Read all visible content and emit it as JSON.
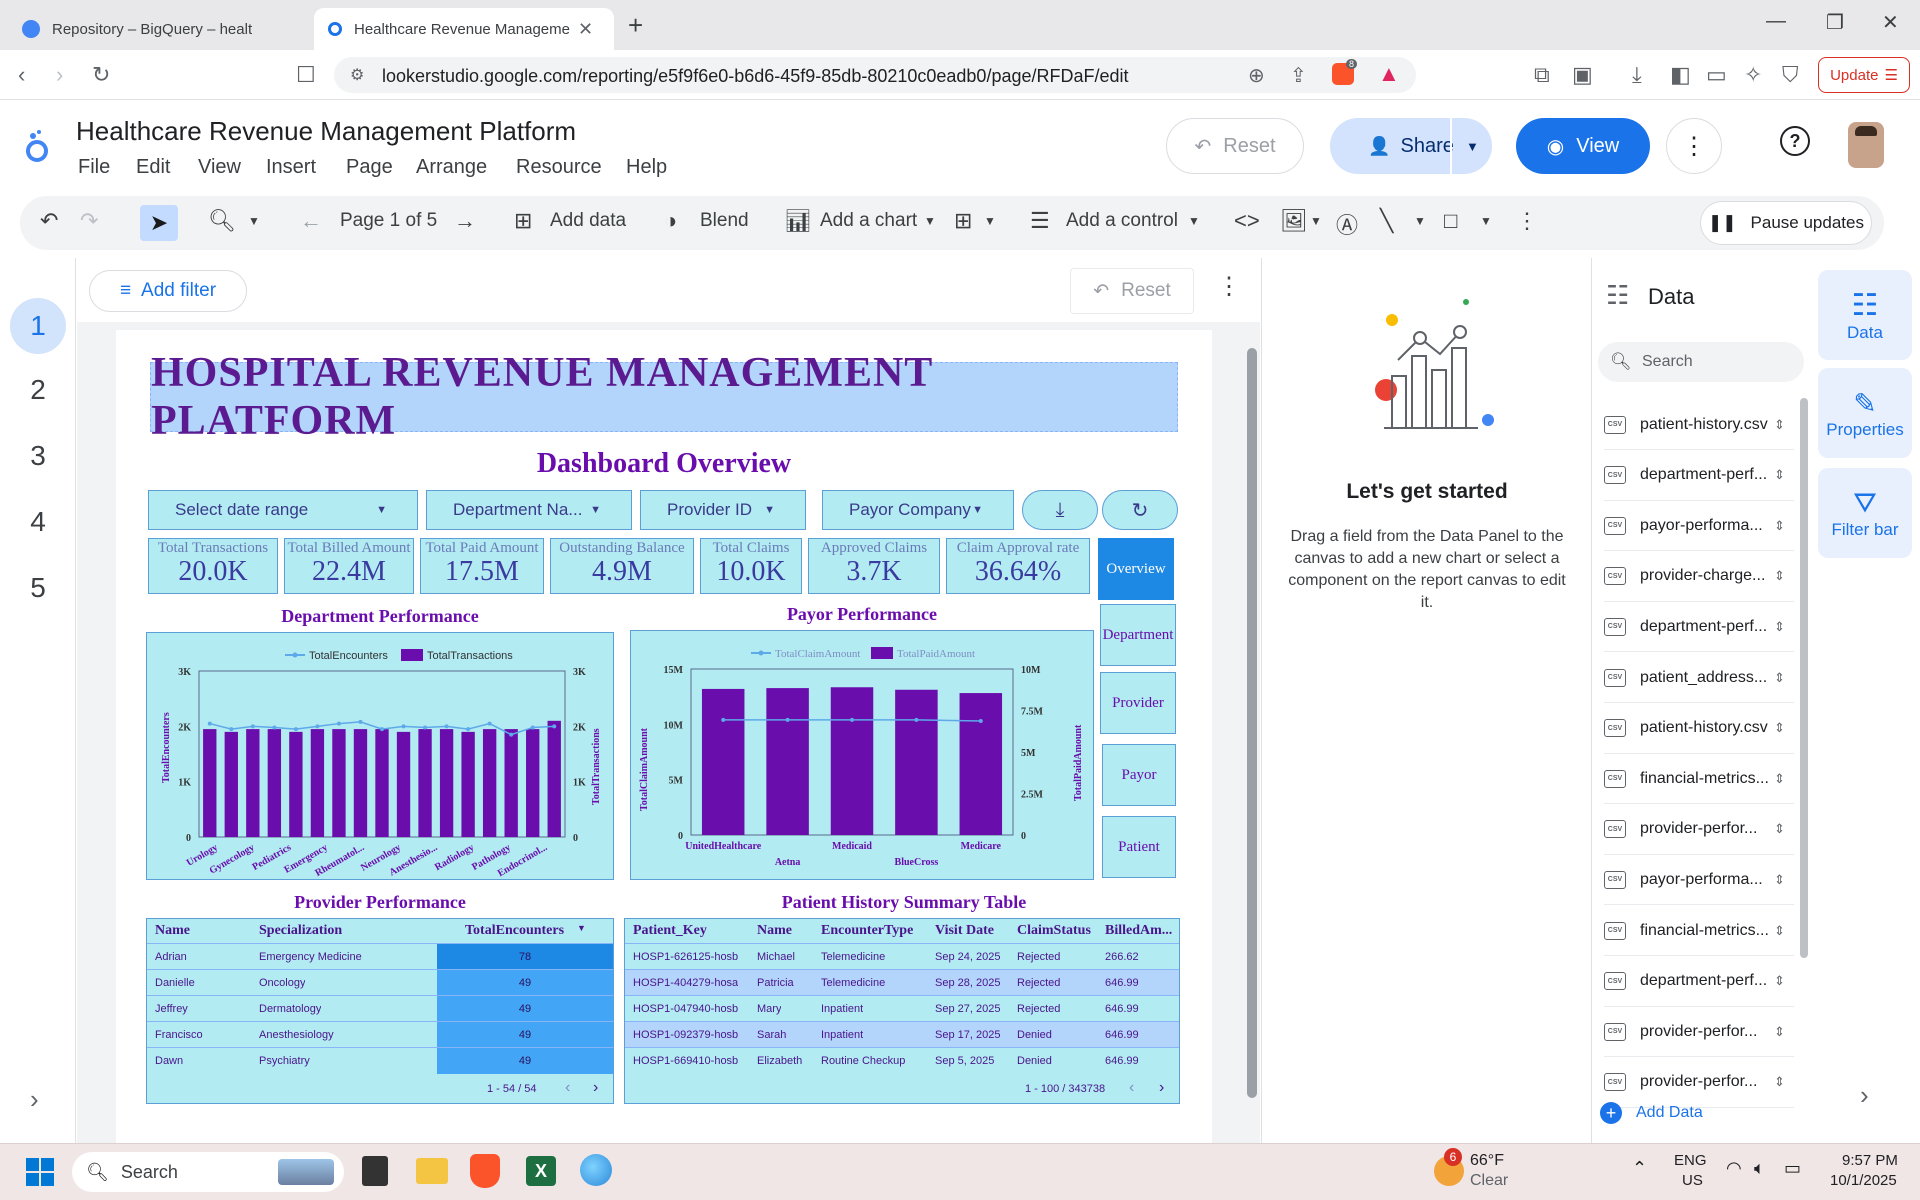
{
  "browser": {
    "tabs": [
      {
        "label": "Repository – BigQuery – healthcare d",
        "active": false
      },
      {
        "label": "Healthcare Revenue Managemen",
        "active": true
      }
    ],
    "url": "lookerstudio.google.com/reporting/e5f9f6e0-b6d6-45f9-85db-80210c0eadb0/page/RFDaF/edit",
    "update_label": "Update",
    "extension_badge": "8"
  },
  "app": {
    "report_title": "Healthcare Revenue Management Platform",
    "menus": [
      "File",
      "Edit",
      "View",
      "Insert",
      "Page",
      "Arrange",
      "Resource",
      "Help"
    ],
    "reset_label": "Reset",
    "share_label": "Share",
    "view_label": "View"
  },
  "toolbar": {
    "page_indicator": "Page 1 of 5",
    "add_data": "Add data",
    "blend": "Blend",
    "add_chart": "Add a chart",
    "add_control": "Add a control",
    "pause_updates": "Pause updates"
  },
  "pages": [
    "1",
    "2",
    "3",
    "4",
    "5"
  ],
  "filterbar": {
    "add_filter": "Add filter",
    "reset": "Reset"
  },
  "dashboard": {
    "banner": "HOSPITAL REVENUE MANAGEMENT PLATFORM",
    "subtitle": "Dashboard Overview",
    "controls": [
      "Select date range",
      "Department Na...",
      "Provider ID",
      "Payor Company"
    ],
    "kpis": [
      {
        "label": "Total Transactions",
        "value": "20.0K"
      },
      {
        "label": "Total Billed Amount",
        "value": "22.4M"
      },
      {
        "label": "Total Paid Amount",
        "value": "17.5M"
      },
      {
        "label": "Outstanding Balance",
        "value": "4.9M"
      },
      {
        "label": "Total Claims",
        "value": "10.0K"
      },
      {
        "label": "Approved Claims",
        "value": "3.7K"
      },
      {
        "label": "Claim Approval rate",
        "value": "36.64%"
      }
    ],
    "nav_buttons": [
      "Overview",
      "Department",
      "Provider",
      "Payor",
      "Patient"
    ],
    "dept_title": "Department Performance",
    "payor_title": "Payor Performance",
    "provider_title": "Provider Performance",
    "patient_title": "Patient History Summary Table"
  },
  "chart_data": [
    {
      "type": "bar",
      "title": "Department Performance",
      "series": [
        {
          "name": "TotalEncounters",
          "kind": "line",
          "values": [
            2050,
            1950,
            2000,
            1980,
            1950,
            2000,
            2050,
            2080,
            1950,
            2000,
            1980,
            2000,
            1950,
            2050,
            1850,
            1980,
            2000
          ]
        },
        {
          "name": "TotalTransactions",
          "kind": "bar",
          "values": [
            1950,
            1900,
            1950,
            1950,
            1900,
            1950,
            1950,
            1950,
            1950,
            1900,
            1950,
            1950,
            1900,
            1950,
            1950,
            1950,
            2100
          ]
        }
      ],
      "category_labels": [
        "Urology",
        "Gynecology",
        "Pediatrics",
        "Emergency",
        "Rheumatol...",
        "Neurology",
        "Anesthesio...",
        "Radiology",
        "Pathology",
        "Endocrinol..."
      ],
      "ylabel_left": "TotalEncounters",
      "ylabel_right": "TotalTransactions",
      "yticks": [
        "0",
        "1K",
        "2K",
        "3K"
      ],
      "ylim": [
        0,
        3000
      ]
    },
    {
      "type": "bar",
      "title": "Payor Performance",
      "categories": [
        "UnitedHealthcare",
        "Aetna",
        "Medicaid",
        "BlueCross",
        "Medicare"
      ],
      "series": [
        {
          "name": "TotalClaimAmount",
          "kind": "line",
          "values": [
            10400000,
            10400000,
            10400000,
            10400000,
            10300000
          ]
        },
        {
          "name": "TotalPaidAmount",
          "kind": "bar",
          "values": [
            8800000,
            8850000,
            8900000,
            8750000,
            8550000
          ]
        }
      ],
      "ylabel_left": "TotalClaimAmount",
      "ylabel_right": "TotalPaidAmount",
      "yticks_left": [
        "0",
        "5M",
        "10M",
        "15M"
      ],
      "yticks_right": [
        "0",
        "2.5M",
        "5M",
        "7.5M",
        "10M"
      ],
      "ylim_left": [
        0,
        15000000
      ],
      "ylim_right": [
        0,
        10000000
      ]
    }
  ],
  "provider_table": {
    "columns": [
      "Name",
      "Specialization",
      "TotalEncounters"
    ],
    "rows": [
      [
        "Adrian",
        "Emergency Medicine",
        "78"
      ],
      [
        "Danielle",
        "Oncology",
        "49"
      ],
      [
        "Jeffrey",
        "Dermatology",
        "49"
      ],
      [
        "Francisco",
        "Anesthesiology",
        "49"
      ],
      [
        "Dawn",
        "Psychiatry",
        "49"
      ]
    ],
    "pagination": "1 - 54 / 54"
  },
  "patient_table": {
    "columns": [
      "Patient_Key",
      "Name",
      "EncounterType",
      "Visit Date",
      "ClaimStatus",
      "BilledAm..."
    ],
    "rows": [
      [
        "HOSP1-626125-hosb",
        "Michael",
        "Telemedicine",
        "Sep 24, 2025",
        "Rejected",
        "266.62"
      ],
      [
        "HOSP1-404279-hosa",
        "Patricia",
        "Telemedicine",
        "Sep 28, 2025",
        "Rejected",
        "646.99"
      ],
      [
        "HOSP1-047940-hosb",
        "Mary",
        "Inpatient",
        "Sep 27, 2025",
        "Rejected",
        "646.99"
      ],
      [
        "HOSP1-092379-hosb",
        "Sarah",
        "Inpatient",
        "Sep 17, 2025",
        "Denied",
        "646.99"
      ],
      [
        "HOSP1-669410-hosb",
        "Elizabeth",
        "Routine Checkup",
        "Sep 5, 2025",
        "Denied",
        "646.99"
      ]
    ],
    "pagination": "1 - 100 / 343738"
  },
  "info_panel": {
    "heading": "Let's get started",
    "body": "Drag a field from the Data Panel to the canvas to add a new chart or select a component on the report canvas to edit it."
  },
  "data_panel": {
    "title": "Data",
    "search_placeholder": "Search",
    "sources": [
      "patient-history.csv",
      "department-perf...",
      "payor-performa...",
      "provider-charge...",
      "department-perf...",
      "patient_address....",
      "patient-history.csv",
      "financial-metrics....",
      "provider-perfor...",
      "payor-performa...",
      "financial-metrics....",
      "department-perf...",
      "provider-perfor...",
      "provider-perfor..."
    ],
    "add_data": "Add Data"
  },
  "side_rail": [
    "Data",
    "Properties",
    "Filter bar"
  ],
  "taskbar": {
    "search": "Search",
    "weather_temp": "66°F",
    "weather_desc": "Clear",
    "weather_badge": "6",
    "lang": "ENG",
    "region": "US",
    "time": "9:57 PM",
    "date": "10/1/2025"
  }
}
